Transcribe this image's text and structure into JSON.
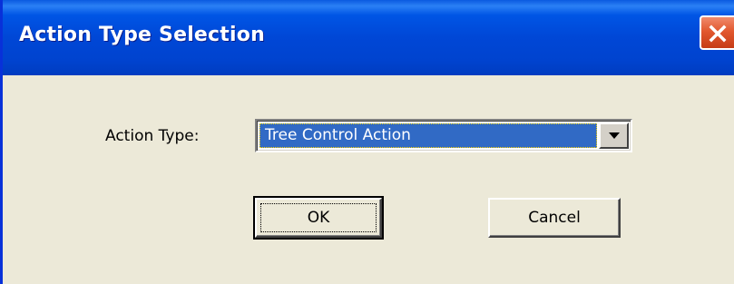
{
  "window": {
    "title": "Action Type Selection",
    "close_icon": "close-x-icon"
  },
  "form": {
    "action_type_label": "Action Type:",
    "action_type_value": "Tree Control Action",
    "dropdown_icon": "chevron-down-icon"
  },
  "buttons": {
    "ok_label": "OK",
    "cancel_label": "Cancel"
  },
  "colors": {
    "titlebar": "#0047d6",
    "dialog_background": "#ece9d8",
    "selection": "#316ac5",
    "close_button": "#e2582f"
  }
}
